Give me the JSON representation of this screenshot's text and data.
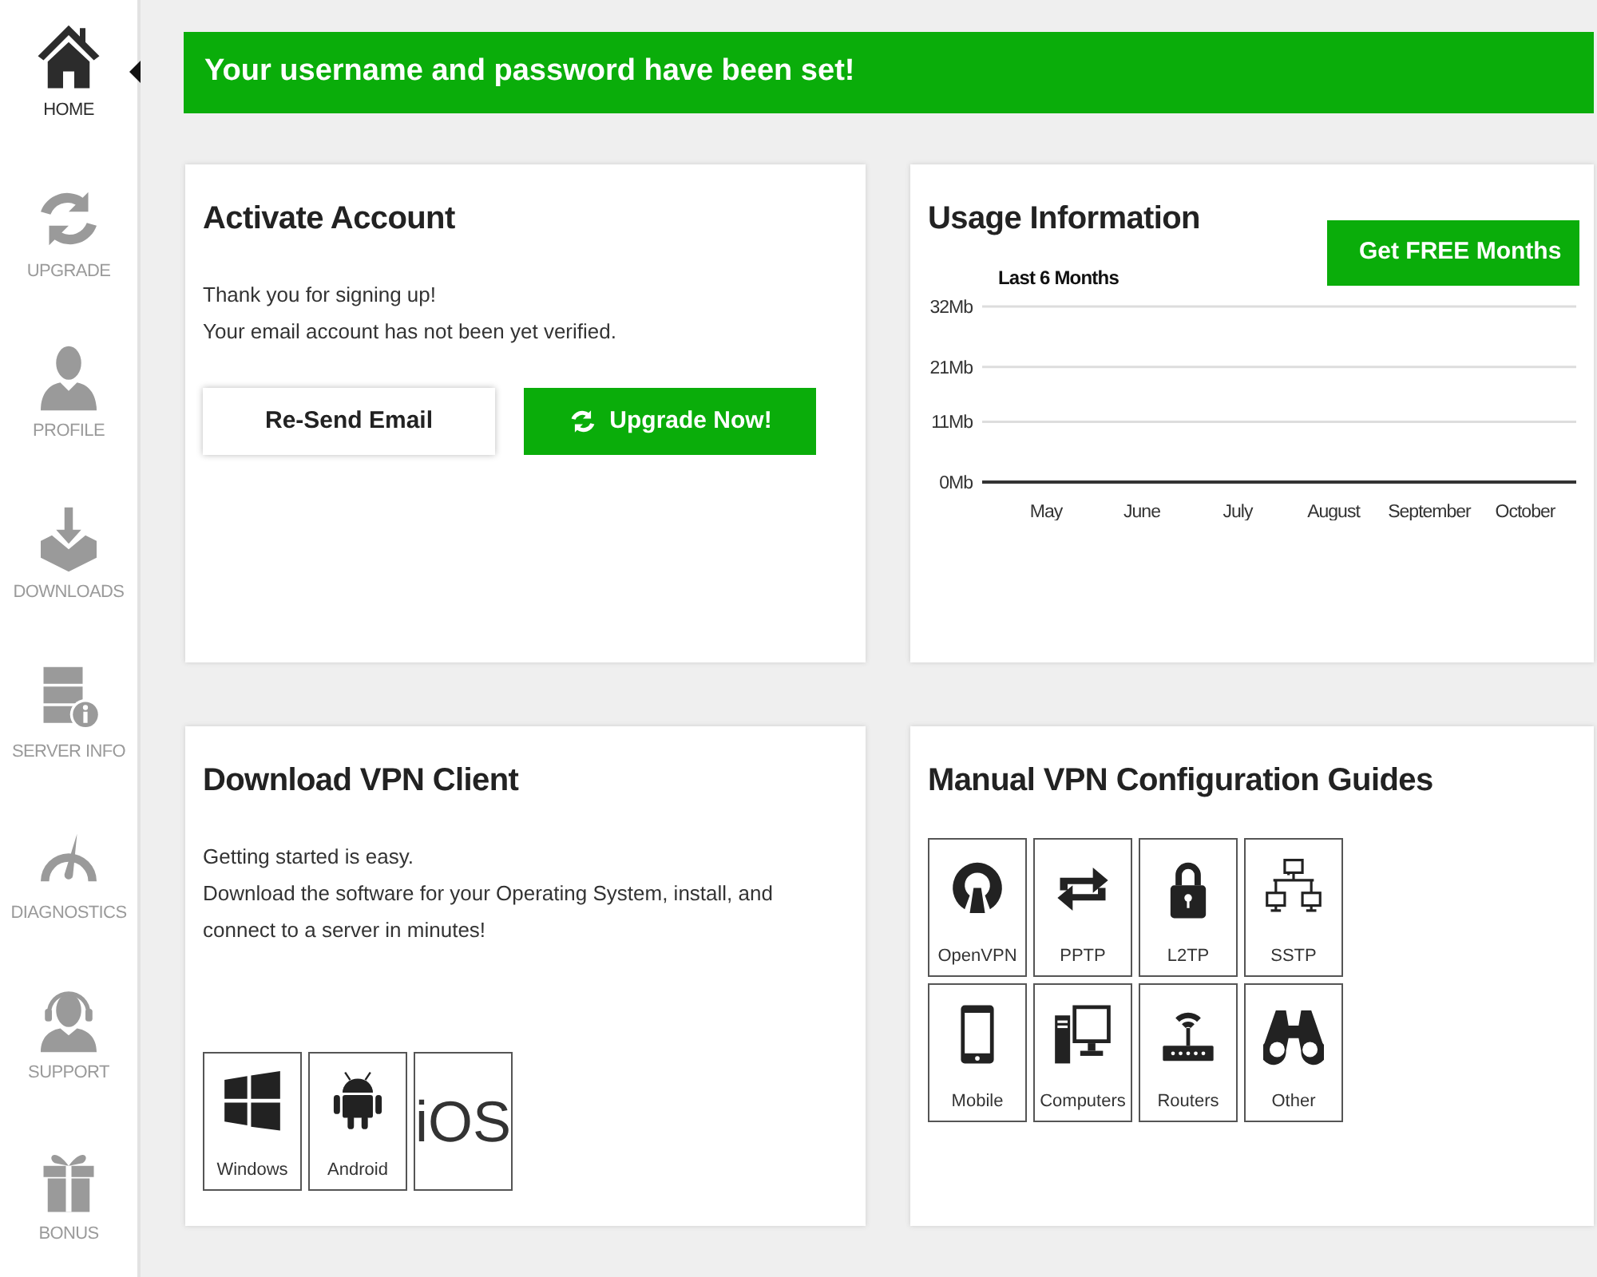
{
  "sidebar": {
    "items": [
      {
        "label": "HOME",
        "selected": true
      },
      {
        "label": "UPGRADE",
        "selected": false
      },
      {
        "label": "PROFILE",
        "selected": false
      },
      {
        "label": "DOWNLOADS",
        "selected": false
      },
      {
        "label": "SERVER INFO",
        "selected": false
      },
      {
        "label": "DIAGNOSTICS",
        "selected": false
      },
      {
        "label": "SUPPORT",
        "selected": false
      },
      {
        "label": "BONUS",
        "selected": false
      }
    ]
  },
  "banner": "Your username and password have been set!",
  "activate": {
    "title": "Activate Account",
    "lines": [
      "Thank you for signing up!",
      "Your email account has not been yet verified."
    ],
    "resend_button": "Re-Send Email",
    "upgrade_button": "Upgrade Now!"
  },
  "usage": {
    "title": "Usage Information",
    "free_button": "Get FREE Months",
    "chart_data": {
      "type": "line",
      "title": "Last 6 Months",
      "categories": [
        "May",
        "June",
        "July",
        "August",
        "September",
        "October"
      ],
      "ylim": [
        0,
        32
      ],
      "yticks": [
        {
          "value": 0,
          "label": "0Mb"
        },
        {
          "value": 11,
          "label": "11Mb"
        },
        {
          "value": 21,
          "label": "21Mb"
        },
        {
          "value": 32,
          "label": "32Mb"
        }
      ]
    }
  },
  "download": {
    "title": "Download VPN Client",
    "lines": [
      "Getting started is easy.",
      "Download the software for your Operating System, install, and connect to a server in minutes!"
    ],
    "platforms": [
      {
        "kind": "icon",
        "label": "Windows"
      },
      {
        "kind": "icon",
        "label": "Android"
      },
      {
        "kind": "wordmark",
        "label": "iOS"
      }
    ]
  },
  "guides": {
    "title": "Manual VPN Configuration Guides",
    "items": [
      {
        "label": "OpenVPN"
      },
      {
        "label": "PPTP"
      },
      {
        "label": "L2TP"
      },
      {
        "label": "SSTP"
      },
      {
        "label": "Mobile"
      },
      {
        "label": "Computers"
      },
      {
        "label": "Routers"
      },
      {
        "label": "Other"
      }
    ]
  }
}
